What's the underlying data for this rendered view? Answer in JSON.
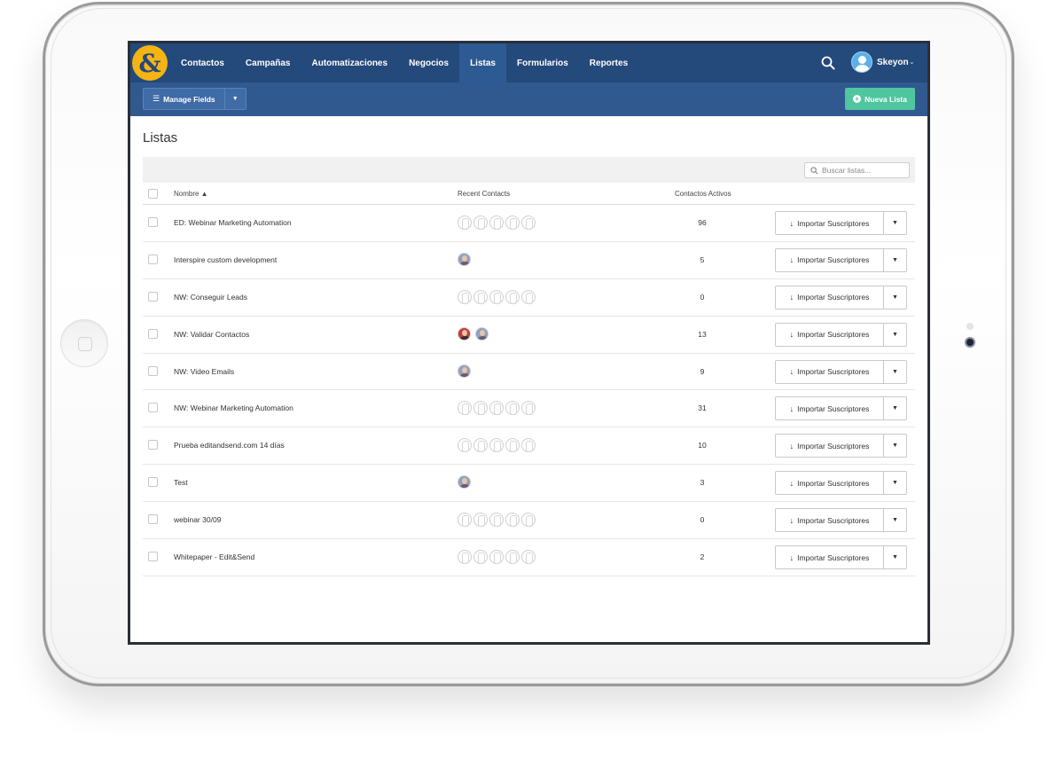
{
  "nav": {
    "logo": "&",
    "items": [
      {
        "label": "Contactos",
        "active": false
      },
      {
        "label": "Campañas",
        "active": false
      },
      {
        "label": "Automatizaciones",
        "active": false
      },
      {
        "label": "Negocios",
        "active": false
      },
      {
        "label": "Listas",
        "active": true
      },
      {
        "label": "Formularios",
        "active": false
      },
      {
        "label": "Reportes",
        "active": false
      }
    ],
    "search_icon": "search-icon",
    "user": {
      "name": "Skeyon",
      "avatar_icon": "user-avatar-icon",
      "caret": "⌄"
    }
  },
  "toolbar": {
    "manage_fields_label": "Manage Fields",
    "manage_fields_icon": "list-icon",
    "nueva_lista_label": "Nueva Lista",
    "nueva_lista_icon": "plus-circle-icon"
  },
  "page": {
    "title": "Listas",
    "search_placeholder": "Buscar listas..."
  },
  "table": {
    "columns": {
      "nombre": "Nombre ▲",
      "recent": "Recent Contacts",
      "activos": "Contactos Activos"
    },
    "action_label": "Importar Suscriptores",
    "action_icon": "download-arrow-icon",
    "rows": [
      {
        "name": "ED: Webinar Marketing Automation",
        "count": "96",
        "recent": {
          "type": "placeholders",
          "n": 5
        }
      },
      {
        "name": "Interspire custom development",
        "count": "5",
        "recent": {
          "type": "avatars",
          "n": 1
        }
      },
      {
        "name": "NW: Conseguir Leads",
        "count": "0",
        "recent": {
          "type": "placeholders",
          "n": 5
        }
      },
      {
        "name": "NW: Validar Contactos",
        "count": "13",
        "recent": {
          "type": "avatars",
          "n": 2
        }
      },
      {
        "name": "NW: Video Emails",
        "count": "9",
        "recent": {
          "type": "avatars",
          "n": 1
        }
      },
      {
        "name": "NW: Webinar Marketing Automation",
        "count": "31",
        "recent": {
          "type": "placeholders",
          "n": 5
        }
      },
      {
        "name": "Prueba editandsend.com 14 días",
        "count": "10",
        "recent": {
          "type": "placeholders",
          "n": 5
        }
      },
      {
        "name": "Test",
        "count": "3",
        "recent": {
          "type": "avatars",
          "n": 1
        }
      },
      {
        "name": "webinar 30/09",
        "count": "0",
        "recent": {
          "type": "placeholders",
          "n": 5
        }
      },
      {
        "name": "Whitepaper - Edit&Send",
        "count": "2",
        "recent": {
          "type": "placeholders",
          "n": 5
        }
      }
    ]
  },
  "colors": {
    "nav_bg": "#24497b",
    "nav_active": "#2e5a93",
    "subbar_bg": "#30598f",
    "logo": "#f6b413",
    "nueva_lista": "#4fc69e"
  }
}
